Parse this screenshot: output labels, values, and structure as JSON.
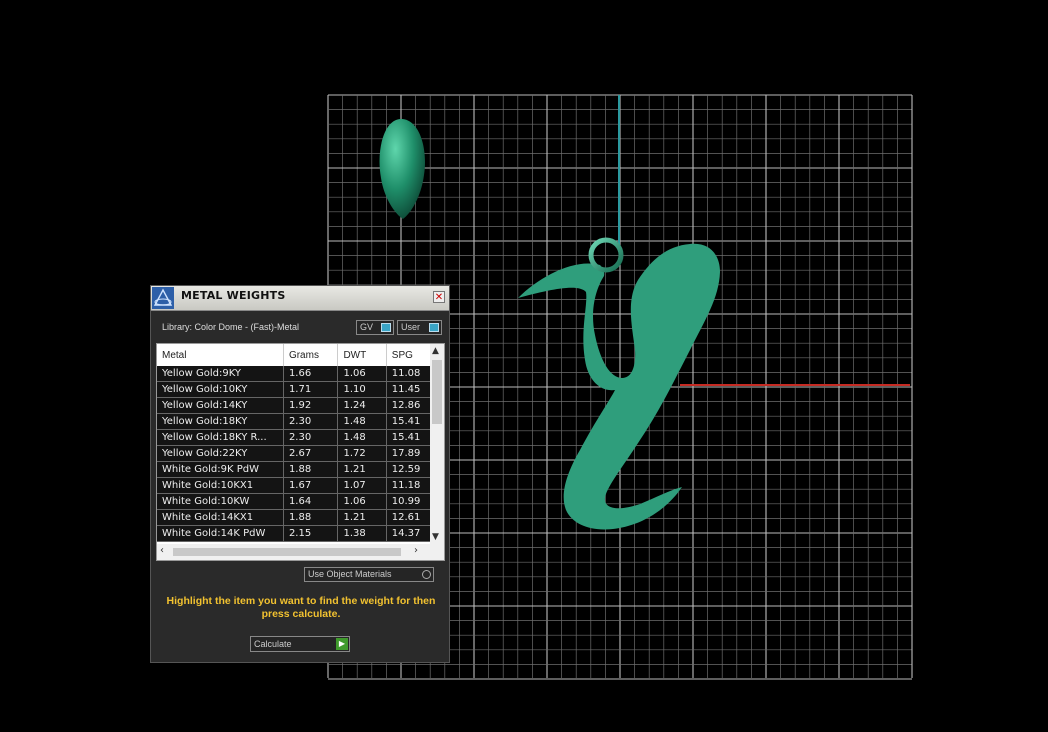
{
  "panel": {
    "title": "METAL WEIGHTS",
    "library_label": "Library: Color Dome - (Fast)-Metal",
    "toggles": [
      {
        "label": "GV"
      },
      {
        "label": "User"
      }
    ],
    "columns": [
      "Metal",
      "Grams",
      "DWT",
      "SPG"
    ],
    "rows": [
      [
        "Yellow Gold:9KY",
        "1.66",
        "1.06",
        "11.08"
      ],
      [
        "Yellow Gold:10KY",
        "1.71",
        "1.10",
        "11.45"
      ],
      [
        "Yellow Gold:14KY",
        "1.92",
        "1.24",
        "12.86"
      ],
      [
        "Yellow Gold:18KY",
        "2.30",
        "1.48",
        "15.41"
      ],
      [
        "Yellow Gold:18KY R...",
        "2.30",
        "1.48",
        "15.41"
      ],
      [
        "Yellow Gold:22KY",
        "2.67",
        "1.72",
        "17.89"
      ],
      [
        "White Gold:9K PdW",
        "1.88",
        "1.21",
        "12.59"
      ],
      [
        "White Gold:10KX1",
        "1.67",
        "1.07",
        "11.18"
      ],
      [
        "White Gold:10KW",
        "1.64",
        "1.06",
        "10.99"
      ],
      [
        "White Gold:14KX1",
        "1.88",
        "1.21",
        "12.61"
      ],
      [
        "White Gold:14K PdW",
        "2.15",
        "1.38",
        "14.37"
      ]
    ],
    "use_object_materials": "Use Object Materials",
    "instructions": "Highlight the item you want to find the weight for then press calculate.",
    "calculate_label": "Calculate"
  },
  "colors": {
    "background": "#000000",
    "grid": "#9a9a9a",
    "model": "#2f9e7c",
    "axis_vertical": "#2b9aa0",
    "axis_horizontal": "#c62a22",
    "instruction_text": "#f2c230"
  }
}
